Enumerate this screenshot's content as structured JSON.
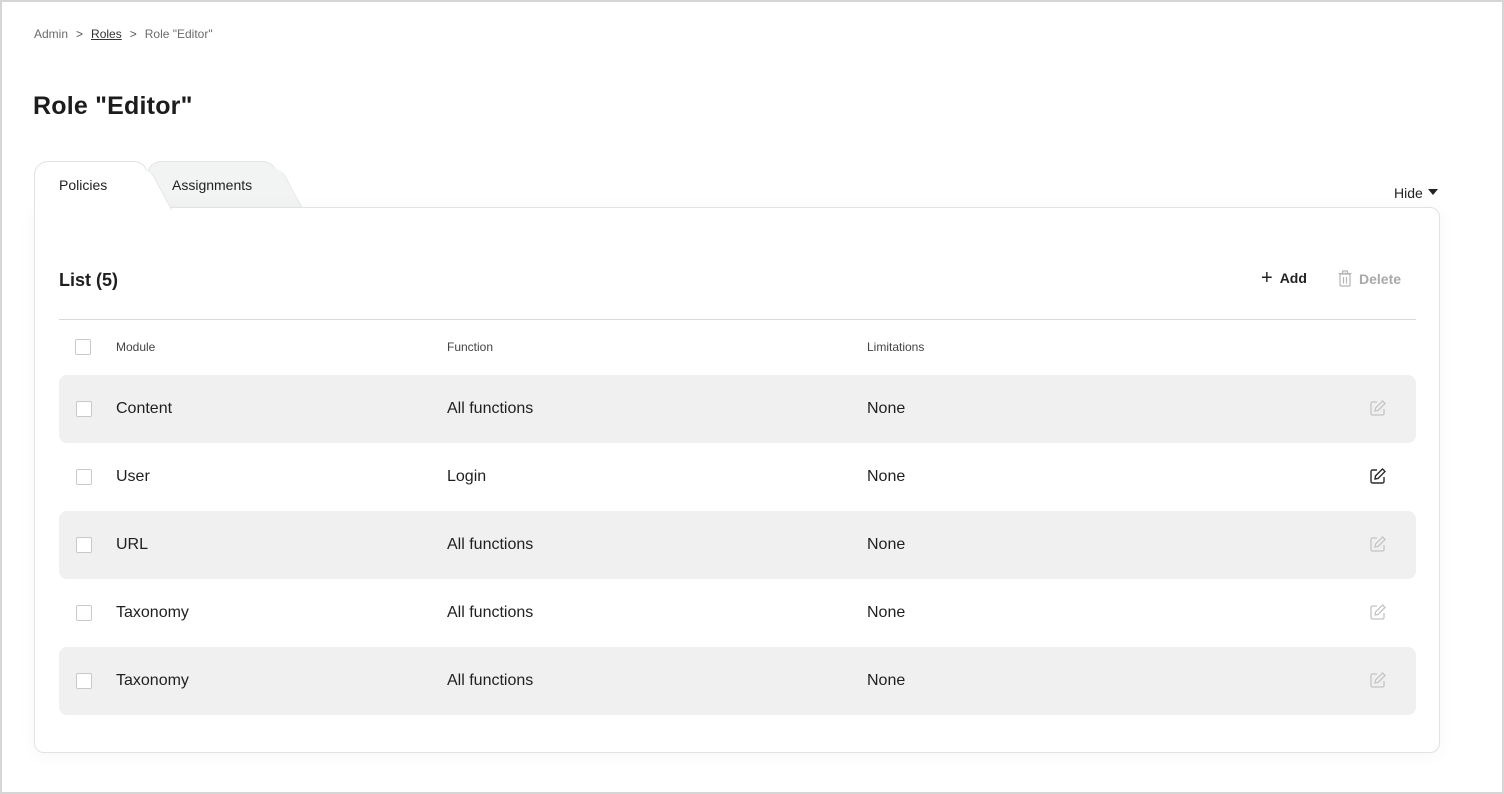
{
  "breadcrumb": {
    "items": [
      "Admin",
      "Roles",
      "Role \"Editor\""
    ],
    "separator": ">"
  },
  "page": {
    "title": "Role \"Editor\""
  },
  "tabs": [
    {
      "label": "Policies",
      "active": true
    },
    {
      "label": "Assignments",
      "active": false
    }
  ],
  "hide_toggle": {
    "label": "Hide"
  },
  "list": {
    "title": "List (5)",
    "add_label": "Add",
    "delete_label": "Delete",
    "columns": [
      "Module",
      "Function",
      "Limitations"
    ],
    "rows": [
      {
        "module": "Content",
        "function": "All functions",
        "limitations": "None",
        "edit_enabled": false
      },
      {
        "module": "User",
        "function": "Login",
        "limitations": "None",
        "edit_enabled": true
      },
      {
        "module": "URL",
        "function": "All functions",
        "limitations": "None",
        "edit_enabled": false
      },
      {
        "module": "Taxonomy",
        "function": "All functions",
        "limitations": "None",
        "edit_enabled": false
      },
      {
        "module": "Taxonomy",
        "function": "All functions",
        "limitations": "None",
        "edit_enabled": false
      }
    ]
  },
  "colors": {
    "row_shade": "#f0f0f0",
    "disabled": "#a9a9a9",
    "border": "#e2e2e2"
  }
}
